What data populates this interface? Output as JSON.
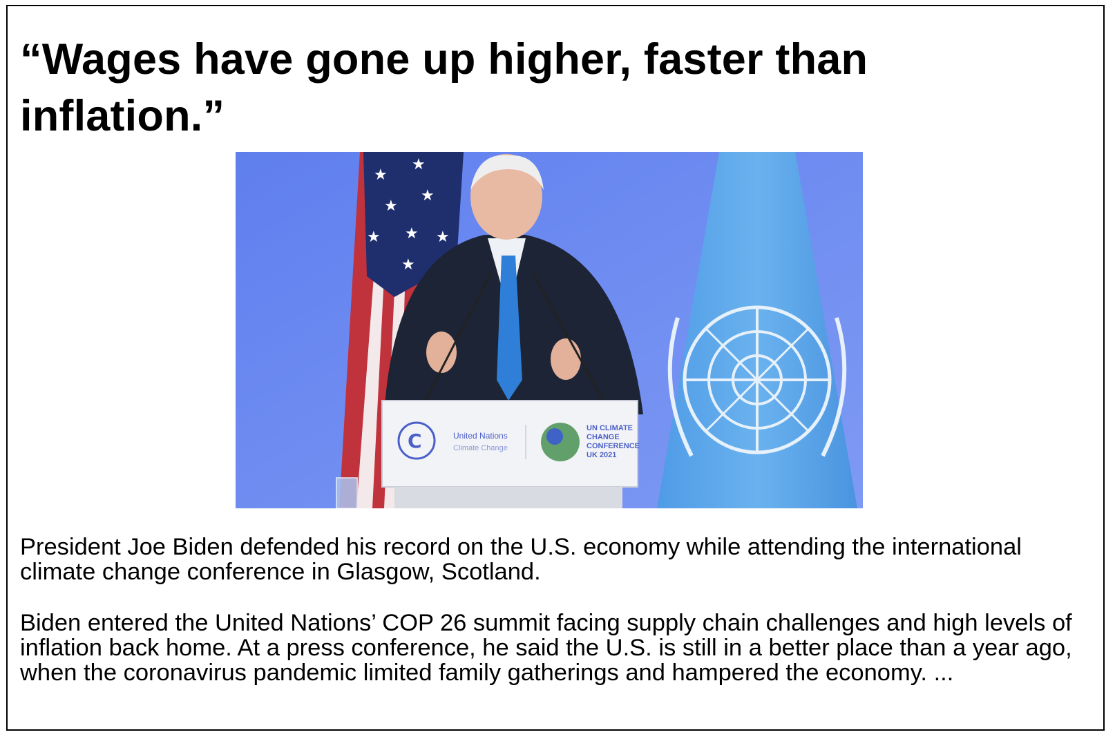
{
  "headline": "“Wages have gone up higher, faster than inflation.”",
  "photo": {
    "podium_sign_left": "United Nations",
    "podium_sign_left_sub": "Climate Change",
    "podium_sign_right": [
      "UN CLIMATE",
      "CHANGE",
      "CONFERENCE",
      "UK 2021"
    ]
  },
  "paragraphs": [
    "President Joe Biden defended his record on the U.S. economy while attending the international climate change conference in Glasgow, Scotland.",
    "Biden entered the United Nations’ COP 26 summit facing supply chain challenges and high levels of inflation back home. At a press conference, he said the U.S. is still in a better place than a year ago, when the coronavirus pandemic limited family gatherings and hampered the economy. ..."
  ],
  "colors": {
    "backdrop": "#6e8cf0",
    "un_flag": "#5aa6e8",
    "suit": "#1c2436",
    "tie": "#2f7fd8",
    "flag_red": "#c0323c"
  }
}
